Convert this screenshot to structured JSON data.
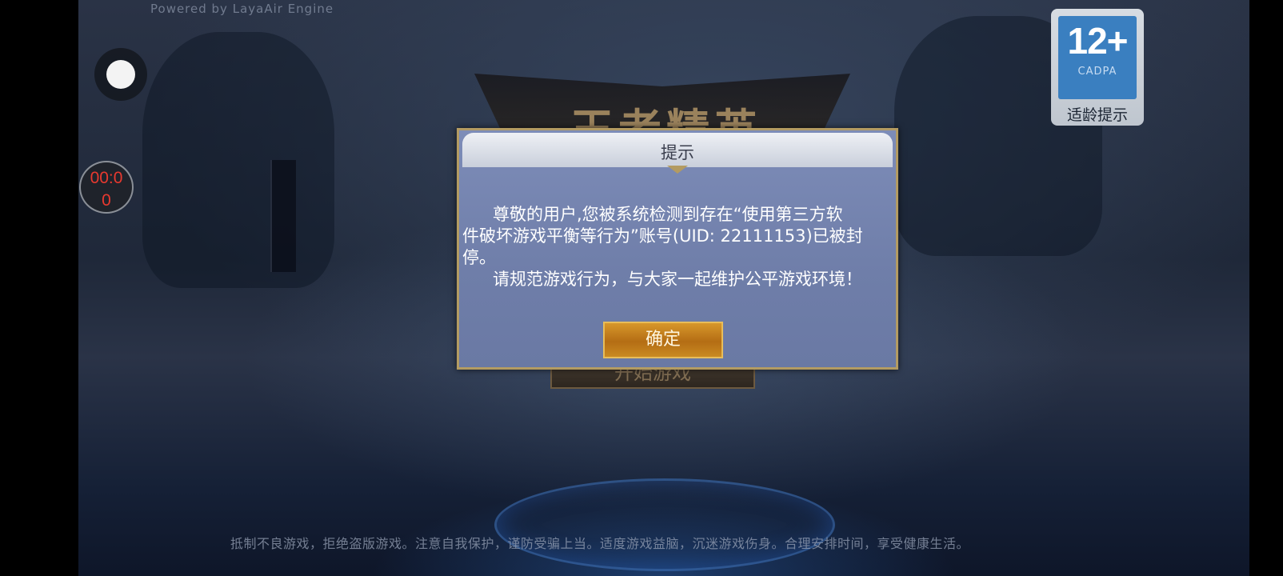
{
  "engine_text": "Powered by LayaAir Engine",
  "logo_text": "王者精英",
  "start_button_label": "开始游戏",
  "health_notice": "抵制不良游戏，拒绝盗版游戏。注意自我保护，谨防受骗上当。适度游戏益脑，沉迷游戏伤身。合理安排时间，享受健康生活。",
  "age_badge": {
    "rating": "12+",
    "org": "CADPA",
    "label": "适龄提示"
  },
  "timer": {
    "line1": "00:0",
    "line2": "0"
  },
  "dialog": {
    "title": "提示",
    "line1": "尊敬的用户,您被系统检测到存在“使用第三方软",
    "line2": "件破坏游戏平衡等行为”账号(UID: 22111153)已被封",
    "line3": "停。",
    "line4": "请规范游戏行为，与大家一起维护公平游戏环境！",
    "confirm_label": "确定"
  },
  "colors": {
    "dialog_border": "#b39b62",
    "confirm_bg": "#c98a22",
    "timer_text": "#e8392f",
    "age_blue": "#3a7fc0"
  }
}
